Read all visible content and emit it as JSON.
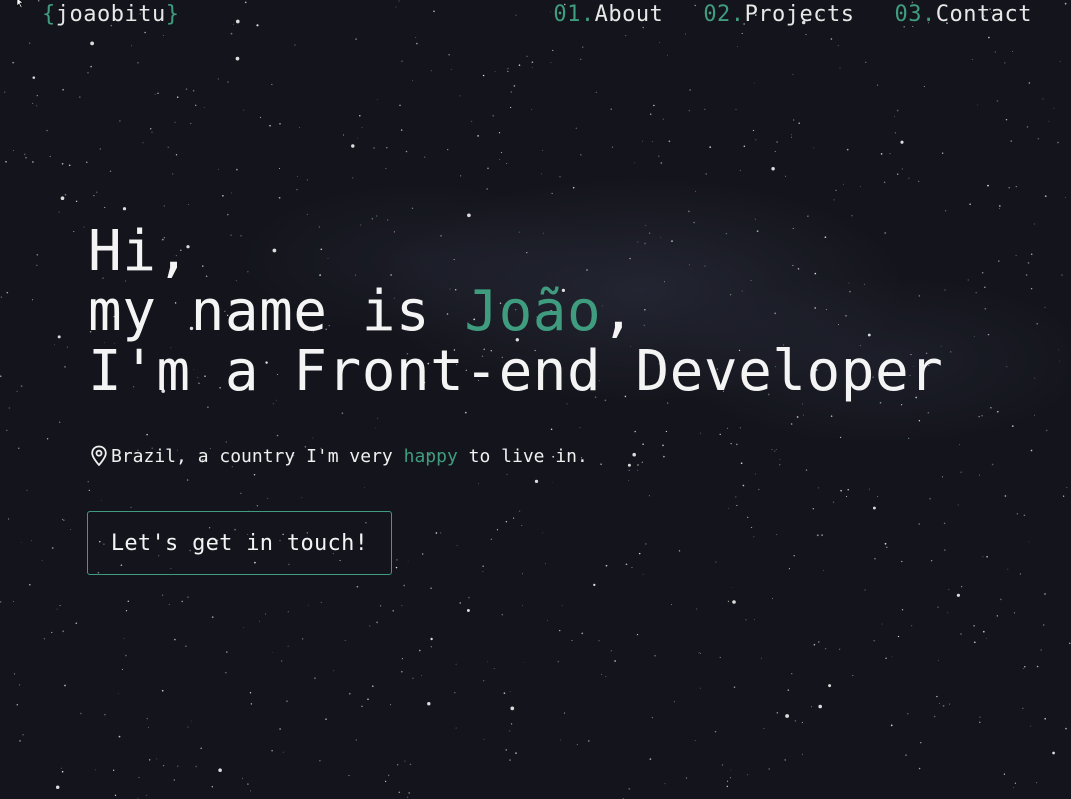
{
  "header": {
    "logo_open": "{",
    "logo_text": "joaobitu",
    "logo_close": "}",
    "nav": [
      {
        "num": "01.",
        "label": "About"
      },
      {
        "num": "02.",
        "label": "Projects"
      },
      {
        "num": "03.",
        "label": "Contact"
      }
    ]
  },
  "hero": {
    "line1": "Hi,",
    "line2_prefix": "my name is ",
    "line2_name": "João",
    "line2_suffix": ",",
    "line3": "I'm a Front-end Developer"
  },
  "location": {
    "icon": "map-pin-icon",
    "text_before": "Brazil, a country I'm very ",
    "highlight": "happy",
    "text_after": " to live in."
  },
  "cta": {
    "label": "Let's get in touch!"
  },
  "colors": {
    "accent": "#3f9c7f",
    "background": "#14151c",
    "text": "#f4f4f4"
  }
}
